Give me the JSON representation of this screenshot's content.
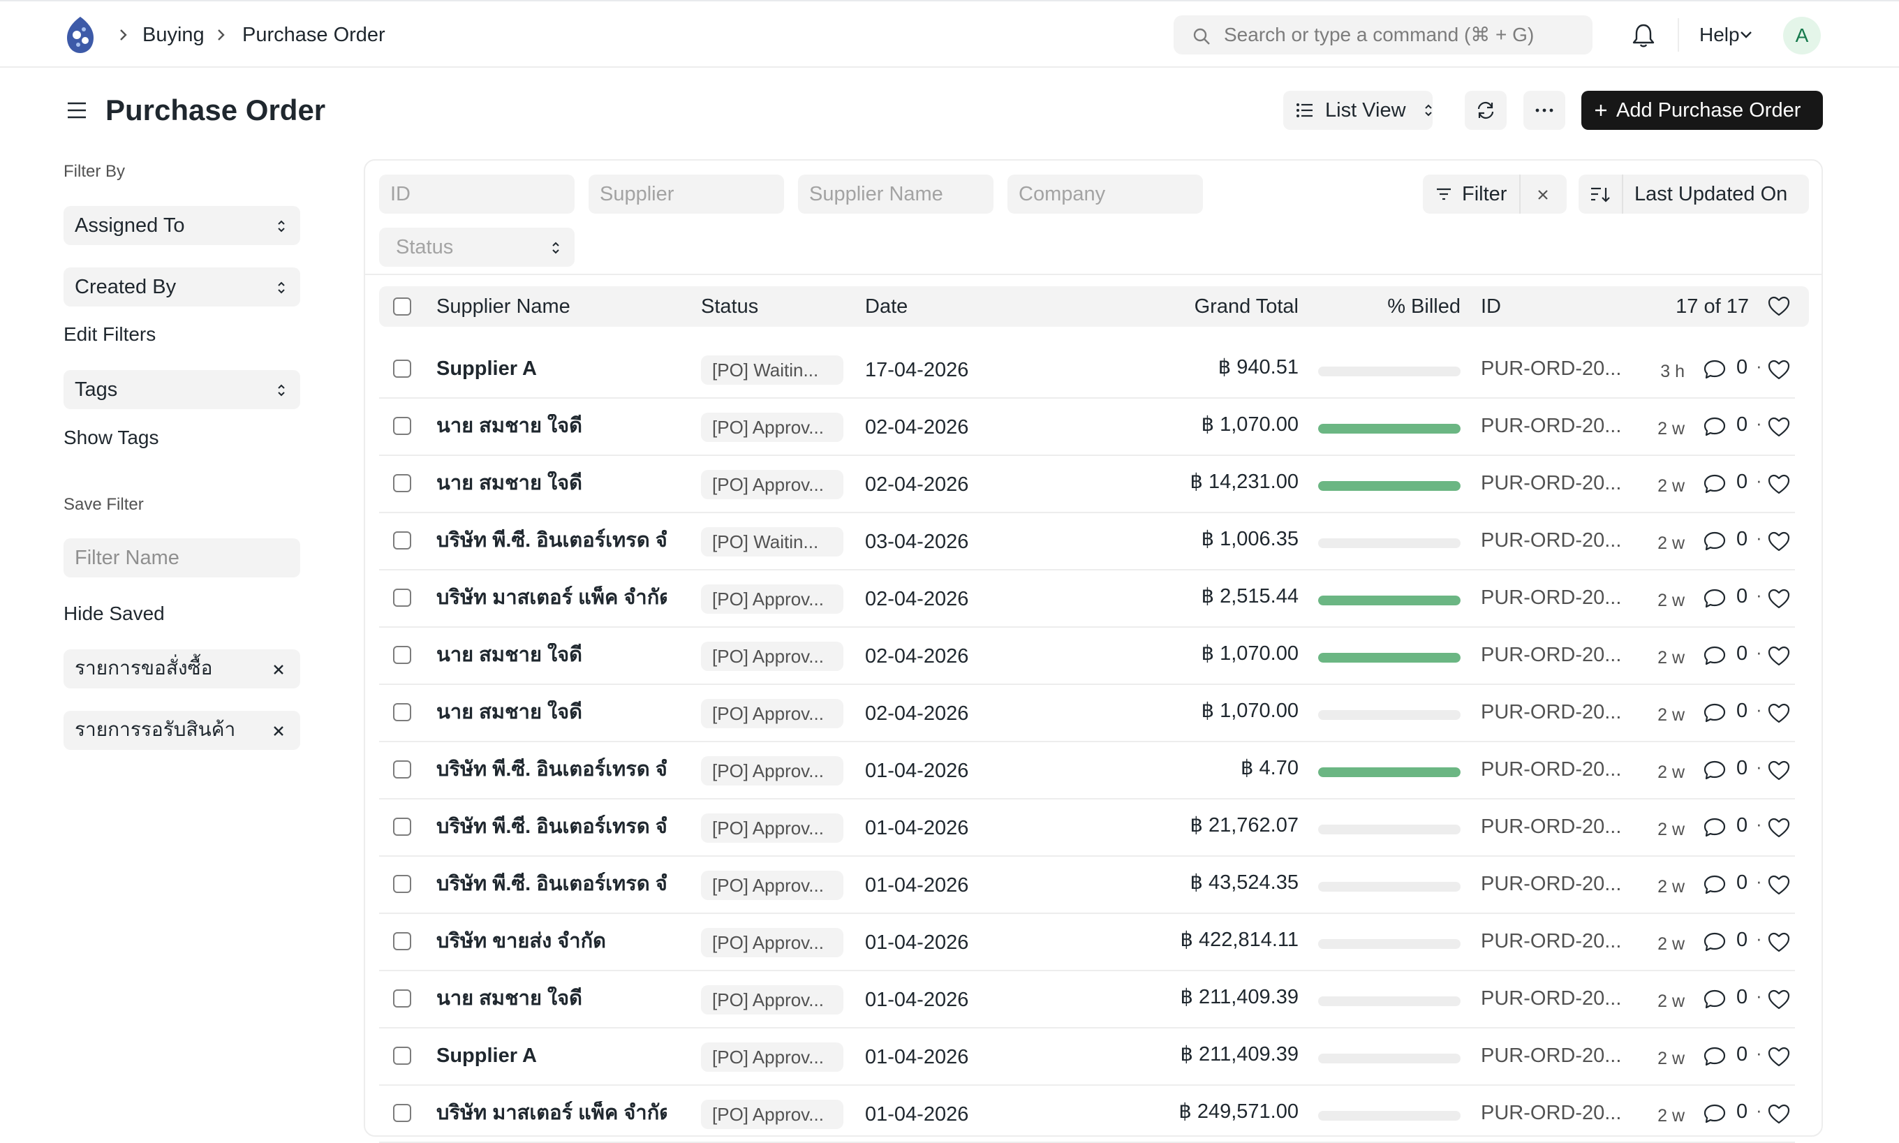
{
  "navbar": {
    "breadcrumbs": [
      "Buying",
      "Purchase Order"
    ],
    "search_placeholder": "Search or type a command (⌘ + G)",
    "help_label": "Help",
    "avatar_initial": "A",
    "icons": [
      "app-logo",
      "chevron-right-icon",
      "search-icon",
      "bell-icon",
      "chevron-down-icon"
    ]
  },
  "page": {
    "title": "Purchase Order",
    "list_view_label": "List View",
    "add_button_label": "Add Purchase Order"
  },
  "sidebar": {
    "filter_by_heading": "Filter By",
    "assigned_to_label": "Assigned To",
    "created_by_label": "Created By",
    "edit_filters_label": "Edit Filters",
    "tags_label": "Tags",
    "show_tags_label": "Show Tags",
    "save_filter_heading": "Save Filter",
    "filter_name_placeholder": "Filter Name",
    "hide_saved_label": "Hide Saved",
    "saved_filters": [
      "รายการขอสั่งซื้อ",
      "รายการรอรับสินค้า"
    ]
  },
  "filters": {
    "id_placeholder": "ID",
    "supplier_placeholder": "Supplier",
    "supplier_name_placeholder": "Supplier Name",
    "company_placeholder": "Company",
    "status_placeholder": "Status",
    "filter_label": "Filter",
    "sort_label": "Last Updated On"
  },
  "table": {
    "columns": {
      "supplier_name": "Supplier Name",
      "status": "Status",
      "date": "Date",
      "grand_total": "Grand Total",
      "billed": "% Billed",
      "id": "ID"
    },
    "count_label": "17 of 17",
    "rows": [
      {
        "supplier": "Supplier A",
        "status": "[PO] Waitin...",
        "date": "17-04-2026",
        "total": "฿ 940.51",
        "billed": 0,
        "id": "PUR-ORD-20...",
        "time": "3 h",
        "comments": "0"
      },
      {
        "supplier": "นาย สมชาย ใจดี",
        "status": "[PO] Approv...",
        "date": "02-04-2026",
        "total": "฿ 1,070.00",
        "billed": 100,
        "id": "PUR-ORD-20...",
        "time": "2 w",
        "comments": "0"
      },
      {
        "supplier": "นาย สมชาย ใจดี",
        "status": "[PO] Approv...",
        "date": "02-04-2026",
        "total": "฿ 14,231.00",
        "billed": 100,
        "id": "PUR-ORD-20...",
        "time": "2 w",
        "comments": "0"
      },
      {
        "supplier": "บริษัท พี.ซี. อินเตอร์เทรด จำกัด",
        "status": "[PO] Waitin...",
        "date": "03-04-2026",
        "total": "฿ 1,006.35",
        "billed": 0,
        "id": "PUR-ORD-20...",
        "time": "2 w",
        "comments": "0"
      },
      {
        "supplier": "บริษัท มาสเตอร์ แพ็ค จำกัด",
        "status": "[PO] Approv...",
        "date": "02-04-2026",
        "total": "฿ 2,515.44",
        "billed": 100,
        "id": "PUR-ORD-20...",
        "time": "2 w",
        "comments": "0"
      },
      {
        "supplier": "นาย สมชาย ใจดี",
        "status": "[PO] Approv...",
        "date": "02-04-2026",
        "total": "฿ 1,070.00",
        "billed": 100,
        "id": "PUR-ORD-20...",
        "time": "2 w",
        "comments": "0"
      },
      {
        "supplier": "นาย สมชาย ใจดี",
        "status": "[PO] Approv...",
        "date": "02-04-2026",
        "total": "฿ 1,070.00",
        "billed": 0,
        "id": "PUR-ORD-20...",
        "time": "2 w",
        "comments": "0"
      },
      {
        "supplier": "บริษัท พี.ซี. อินเตอร์เทรด จำกัด",
        "status": "[PO] Approv...",
        "date": "01-04-2026",
        "total": "฿ 4.70",
        "billed": 100,
        "id": "PUR-ORD-20...",
        "time": "2 w",
        "comments": "0"
      },
      {
        "supplier": "บริษัท พี.ซี. อินเตอร์เทรด จำกัด",
        "status": "[PO] Approv...",
        "date": "01-04-2026",
        "total": "฿ 21,762.07",
        "billed": 0,
        "id": "PUR-ORD-20...",
        "time": "2 w",
        "comments": "0"
      },
      {
        "supplier": "บริษัท พี.ซี. อินเตอร์เทรด จำกัด",
        "status": "[PO] Approv...",
        "date": "01-04-2026",
        "total": "฿ 43,524.35",
        "billed": 0,
        "id": "PUR-ORD-20...",
        "time": "2 w",
        "comments": "0"
      },
      {
        "supplier": "บริษัท ขายส่ง จำกัด",
        "status": "[PO] Approv...",
        "date": "01-04-2026",
        "total": "฿ 422,814.11",
        "billed": 0,
        "id": "PUR-ORD-20...",
        "time": "2 w",
        "comments": "0"
      },
      {
        "supplier": "นาย สมชาย ใจดี",
        "status": "[PO] Approv...",
        "date": "01-04-2026",
        "total": "฿ 211,409.39",
        "billed": 0,
        "id": "PUR-ORD-20...",
        "time": "2 w",
        "comments": "0"
      },
      {
        "supplier": "Supplier A",
        "status": "[PO] Approv...",
        "date": "01-04-2026",
        "total": "฿ 211,409.39",
        "billed": 0,
        "id": "PUR-ORD-20...",
        "time": "2 w",
        "comments": "0"
      },
      {
        "supplier": "บริษัท มาสเตอร์ แพ็ค จำกัด",
        "status": "[PO] Approv...",
        "date": "01-04-2026",
        "total": "฿ 249,571.00",
        "billed": 0,
        "id": "PUR-ORD-20...",
        "time": "2 w",
        "comments": "0"
      }
    ]
  },
  "colors": {
    "primary_button": "#171717",
    "billed_bar": "#6bb683",
    "avatar_bg": "#e4f5e9",
    "avatar_text": "#16794c"
  }
}
